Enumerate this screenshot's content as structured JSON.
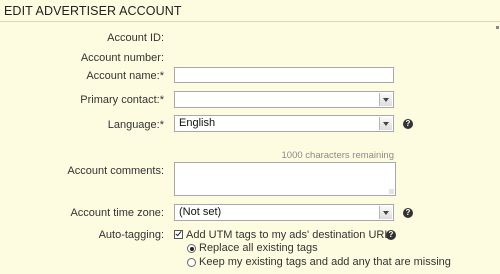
{
  "header": {
    "title": "EDIT ADVERTISER ACCOUNT"
  },
  "form": {
    "account_id_label": "Account ID:",
    "account_number_label": "Account number:",
    "account_name": {
      "label": "Account name:*",
      "value": ""
    },
    "primary_contact": {
      "label": "Primary contact:*",
      "value": ""
    },
    "language": {
      "label": "Language:*",
      "value": "English"
    },
    "comments": {
      "label": "Account comments:",
      "remaining": "1000 characters remaining",
      "value": ""
    },
    "time_zone": {
      "label": "Account time zone:",
      "value": "(Not set)"
    },
    "auto_tagging": {
      "label": "Auto-tagging:",
      "checkbox_label": "Add UTM tags to my ads' destination URLs",
      "checked": true,
      "options": [
        {
          "label": "Replace all existing tags",
          "selected": true
        },
        {
          "label": "Keep my existing tags and add any that are missing",
          "selected": false
        }
      ]
    }
  },
  "icons": {
    "help": "help-icon"
  }
}
